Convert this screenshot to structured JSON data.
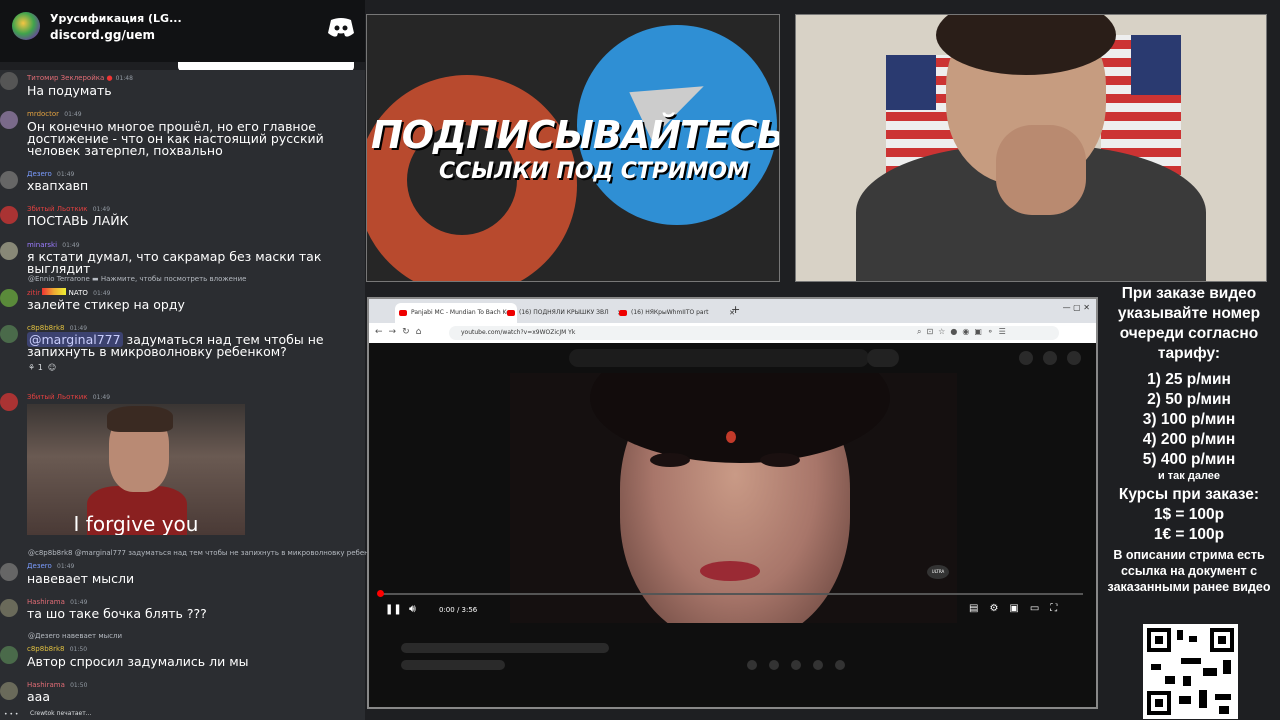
{
  "discord": {
    "server_name": "Урусификация (LG...",
    "invite": "discord.gg/uem"
  },
  "chat": [
    {
      "name": "Титомир Зеклеройка",
      "name_color": "#e06c75",
      "time": "01:48",
      "text": "На подумать"
    },
    {
      "name": "mrdoctor",
      "name_color": "#e0a040",
      "time": "01:49",
      "text": "Он конечно многое прошёл, но его главное достижение - что он как настоящий русский человек затерпел, похвально"
    },
    {
      "name": "Дезеro",
      "name_color": "#7a9cff",
      "time": "01:49",
      "text": "хвапхавп"
    },
    {
      "name": "Збитый Льоткик",
      "name_color": "#e04040",
      "time": "01:49",
      "text": "ПОСТАВЬ ЛАЙК"
    },
    {
      "name": "minarski",
      "name_color": "#9b7cff",
      "time": "01:49",
      "text": "я кстати думал, что сакрамар без маски так выглядит"
    },
    {
      "reply": "@Ennio Terrarone ▬ Нажмите, чтобы посмотреть вложение",
      "name": "zitir",
      "name_color": "#e04040",
      "badge": "NATO",
      "time": "01:49",
      "text": "залейте стикер на орду"
    },
    {
      "name": "c8p8b8rk8",
      "name_color": "#e0c040",
      "time": "01:49",
      "mention": "@marginal777",
      "text": " задуматься над тем чтобы не запихнуть в микроволновку ребенком?",
      "reaction_count": "1"
    },
    {
      "name": "Збитый Льоткик",
      "name_color": "#e04040",
      "time": "01:49",
      "gif_caption": "I forgive you"
    },
    {
      "reply": "@c8p8b8rk8 @marginal777 задуматься над тем чтобы не запихнуть в микроволновку ребенком?",
      "name": "Дезеro",
      "name_color": "#7a9cff",
      "time": "01:49",
      "text": "навевает мысли"
    },
    {
      "name": "Hashirama",
      "name_color": "#e06c75",
      "time": "01:49",
      "text": "та шо таке бочка блять ???"
    },
    {
      "reply": "@Дезеro навевает мысли",
      "name": "c8p8b8rk8",
      "name_color": "#e0c040",
      "time": "01:50",
      "text": "Автор спросил задумались ли мы"
    },
    {
      "name": "Hashirama",
      "name_color": "#e06c75",
      "time": "01:50",
      "text": "ааа"
    }
  ],
  "typing": "Crewtok печатает...",
  "promo": {
    "title": "ПОДПИСЫВАЙТЕСЬ",
    "subtitle": "ССЫЛКИ ПОД СТРИМОМ"
  },
  "browser": {
    "tabs": [
      {
        "label": "Panjabi MC - Mundian To Bach Ke"
      },
      {
        "label": "(16) ПОДНЯЛИ КРЫШКУ ЗВЛ"
      },
      {
        "label": "(16) НЯКрыWhmIITO part"
      }
    ],
    "url": "youtube.com/watch?v=x9WOZicJM Yk",
    "time": "0:00 / 3:56",
    "progress": 0.004,
    "video_badge": "ULTRA"
  },
  "info": {
    "heading": "При заказе видео указывайте номер очереди согласно тарифу:",
    "tariffs": [
      "1) 25 р/мин",
      "2) 50 р/мин",
      "3) 100 р/мин",
      "4) 200 р/мин",
      "5) 400 р/мин"
    ],
    "etc": "и так далее",
    "rates_heading": "Курсы при заказе:",
    "rates": [
      "1$ = 100р",
      "1€ = 100р"
    ],
    "note": "В описании стрима есть ссылка на документ с заказанными ранее видео"
  }
}
